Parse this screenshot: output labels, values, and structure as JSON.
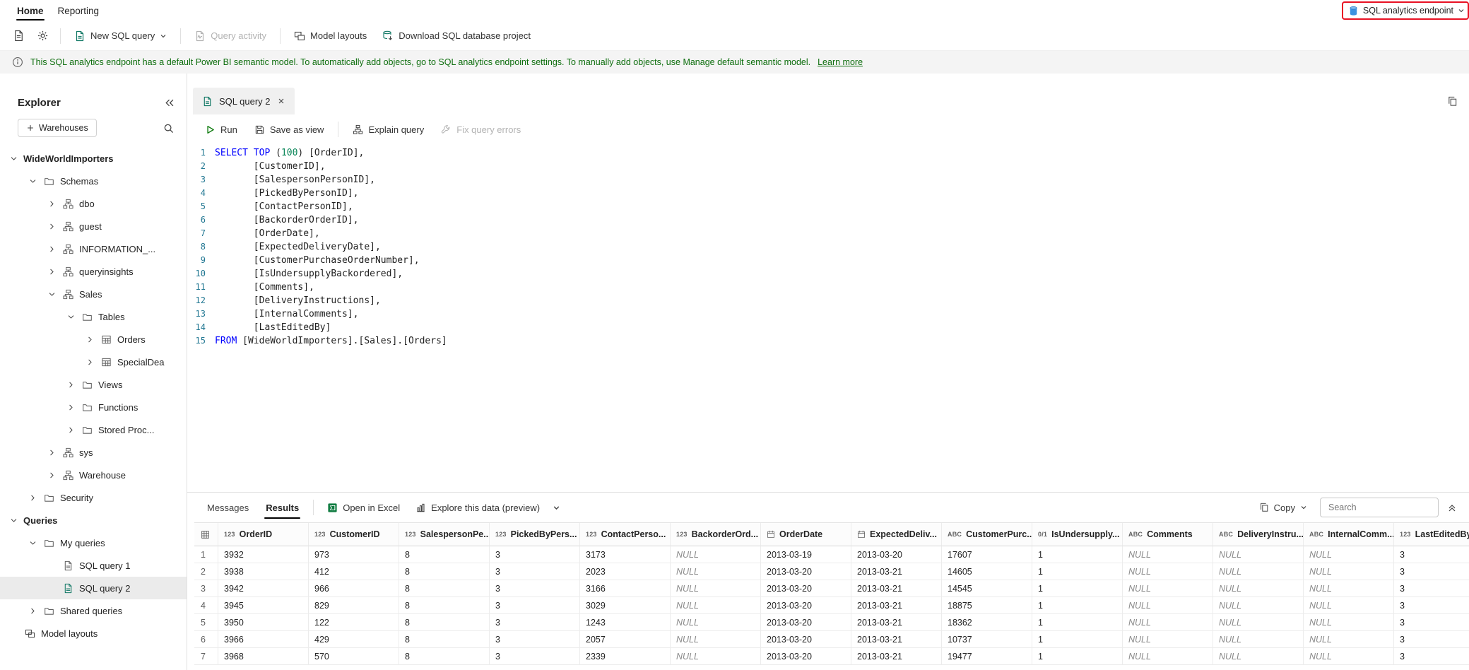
{
  "topbar": {
    "tabs": [
      {
        "label": "Home",
        "active": true
      },
      {
        "label": "Reporting",
        "active": false
      }
    ],
    "endpoint_selector": {
      "label": "SQL analytics endpoint"
    }
  },
  "ribbon": {
    "new_sql_query": "New SQL query",
    "query_activity": "Query activity",
    "model_layouts": "Model layouts",
    "download_project": "Download SQL database project"
  },
  "banner": {
    "text": "This SQL analytics endpoint has a default Power BI semantic model. To automatically add objects, go to SQL analytics endpoint settings. To manually add objects, use Manage default semantic model.",
    "link": "Learn more"
  },
  "explorer": {
    "title": "Explorer",
    "warehouses_button": "Warehouses",
    "tree": [
      {
        "label": "WideWorldImporters",
        "level": 0,
        "expand": true,
        "icon": null,
        "bold": true
      },
      {
        "label": "Schemas",
        "level": 1,
        "expand": true,
        "icon": "folder"
      },
      {
        "label": "dbo",
        "level": 2,
        "expand": false,
        "icon": "schema"
      },
      {
        "label": "guest",
        "level": 2,
        "expand": false,
        "icon": "schema"
      },
      {
        "label": "INFORMATION_...",
        "level": 2,
        "expand": false,
        "icon": "schema"
      },
      {
        "label": "queryinsights",
        "level": 2,
        "expand": false,
        "icon": "schema"
      },
      {
        "label": "Sales",
        "level": 2,
        "expand": true,
        "icon": "schema"
      },
      {
        "label": "Tables",
        "level": 3,
        "expand": true,
        "icon": "folder"
      },
      {
        "label": "Orders",
        "level": 4,
        "expand": false,
        "icon": "table"
      },
      {
        "label": "SpecialDea",
        "level": 4,
        "expand": false,
        "icon": "table"
      },
      {
        "label": "Views",
        "level": 3,
        "expand": false,
        "icon": "folder"
      },
      {
        "label": "Functions",
        "level": 3,
        "expand": false,
        "icon": "folder"
      },
      {
        "label": "Stored Proc...",
        "level": 3,
        "expand": false,
        "icon": "folder"
      },
      {
        "label": "sys",
        "level": 2,
        "expand": false,
        "icon": "schema"
      },
      {
        "label": "Warehouse",
        "level": 2,
        "expand": false,
        "icon": "schema"
      },
      {
        "label": "Security",
        "level": 1,
        "expand": false,
        "icon": "folder"
      },
      {
        "label": "Queries",
        "level": 0,
        "expand": true,
        "icon": null,
        "bold": true
      },
      {
        "label": "My queries",
        "level": 1,
        "expand": true,
        "icon": "folder"
      },
      {
        "label": "SQL query 1",
        "level": 2,
        "expand": null,
        "icon": "query"
      },
      {
        "label": "SQL query 2",
        "level": 2,
        "expand": null,
        "icon": "query-active",
        "selected": true
      },
      {
        "label": "Shared queries",
        "level": 1,
        "expand": false,
        "icon": "folder"
      },
      {
        "label": "Model layouts",
        "level": 0,
        "expand": null,
        "icon": "model"
      }
    ]
  },
  "editor": {
    "tab_label": "SQL query 2",
    "toolbar": {
      "run": "Run",
      "save_as_view": "Save as view",
      "explain_query": "Explain query",
      "fix_query_errors": "Fix query errors"
    },
    "lines": [
      [
        {
          "t": "SELECT",
          "c": "kw"
        },
        {
          "t": " ",
          "c": "pl"
        },
        {
          "t": "TOP",
          "c": "kw"
        },
        {
          "t": " (",
          "c": "pl"
        },
        {
          "t": "100",
          "c": "num"
        },
        {
          "t": ") [OrderID],",
          "c": "pl"
        }
      ],
      [
        {
          "t": "       [CustomerID],",
          "c": "pl"
        }
      ],
      [
        {
          "t": "       [SalespersonPersonID],",
          "c": "pl"
        }
      ],
      [
        {
          "t": "       [PickedByPersonID],",
          "c": "pl"
        }
      ],
      [
        {
          "t": "       [ContactPersonID],",
          "c": "pl"
        }
      ],
      [
        {
          "t": "       [BackorderOrderID],",
          "c": "pl"
        }
      ],
      [
        {
          "t": "       [OrderDate],",
          "c": "pl"
        }
      ],
      [
        {
          "t": "       [ExpectedDeliveryDate],",
          "c": "pl"
        }
      ],
      [
        {
          "t": "       [CustomerPurchaseOrderNumber],",
          "c": "pl"
        }
      ],
      [
        {
          "t": "       [IsUndersupplyBackordered],",
          "c": "pl"
        }
      ],
      [
        {
          "t": "       [Comments],",
          "c": "pl"
        }
      ],
      [
        {
          "t": "       [DeliveryInstructions],",
          "c": "pl"
        }
      ],
      [
        {
          "t": "       [InternalComments],",
          "c": "pl"
        }
      ],
      [
        {
          "t": "       [LastEditedBy]",
          "c": "pl"
        }
      ],
      [
        {
          "t": "FROM",
          "c": "kw"
        },
        {
          "t": " [WideWorldImporters].[Sales].[Orders]",
          "c": "pl"
        }
      ]
    ]
  },
  "results": {
    "tabs": [
      {
        "label": "Messages",
        "active": false
      },
      {
        "label": "Results",
        "active": true
      }
    ],
    "open_in_excel": "Open in Excel",
    "explore_data": "Explore this data (preview)",
    "copy": "Copy",
    "search_placeholder": "Search",
    "type_badges": {
      "num": "123",
      "text": "ABC",
      "bool": "0/1"
    },
    "table": {
      "columns": [
        {
          "type": "num",
          "label": "OrderID"
        },
        {
          "type": "num",
          "label": "CustomerID"
        },
        {
          "type": "num",
          "label": "SalespersonPe..."
        },
        {
          "type": "num",
          "label": "PickedByPers..."
        },
        {
          "type": "num",
          "label": "ContactPerso..."
        },
        {
          "type": "num",
          "label": "BackorderOrd..."
        },
        {
          "type": "date",
          "label": "OrderDate"
        },
        {
          "type": "date",
          "label": "ExpectedDeliv..."
        },
        {
          "type": "text",
          "label": "CustomerPurc..."
        },
        {
          "type": "bool",
          "label": "IsUndersupply..."
        },
        {
          "type": "text",
          "label": "Comments"
        },
        {
          "type": "text",
          "label": "DeliveryInstru..."
        },
        {
          "type": "text",
          "label": "InternalComm..."
        },
        {
          "type": "num",
          "label": "LastEditedBy"
        }
      ],
      "rows": [
        [
          "3932",
          "973",
          "8",
          "3",
          "3173",
          "NULL",
          "2013-03-19",
          "2013-03-20",
          "17607",
          "1",
          "NULL",
          "NULL",
          "NULL",
          "3"
        ],
        [
          "3938",
          "412",
          "8",
          "3",
          "2023",
          "NULL",
          "2013-03-20",
          "2013-03-21",
          "14605",
          "1",
          "NULL",
          "NULL",
          "NULL",
          "3"
        ],
        [
          "3942",
          "966",
          "8",
          "3",
          "3166",
          "NULL",
          "2013-03-20",
          "2013-03-21",
          "14545",
          "1",
          "NULL",
          "NULL",
          "NULL",
          "3"
        ],
        [
          "3945",
          "829",
          "8",
          "3",
          "3029",
          "NULL",
          "2013-03-20",
          "2013-03-21",
          "18875",
          "1",
          "NULL",
          "NULL",
          "NULL",
          "3"
        ],
        [
          "3950",
          "122",
          "8",
          "3",
          "1243",
          "NULL",
          "2013-03-20",
          "2013-03-21",
          "18362",
          "1",
          "NULL",
          "NULL",
          "NULL",
          "3"
        ],
        [
          "3966",
          "429",
          "8",
          "3",
          "2057",
          "NULL",
          "2013-03-20",
          "2013-03-21",
          "10737",
          "1",
          "NULL",
          "NULL",
          "NULL",
          "3"
        ],
        [
          "3968",
          "570",
          "8",
          "3",
          "2339",
          "NULL",
          "2013-03-20",
          "2013-03-21",
          "19477",
          "1",
          "NULL",
          "NULL",
          "NULL",
          "3"
        ]
      ]
    }
  }
}
